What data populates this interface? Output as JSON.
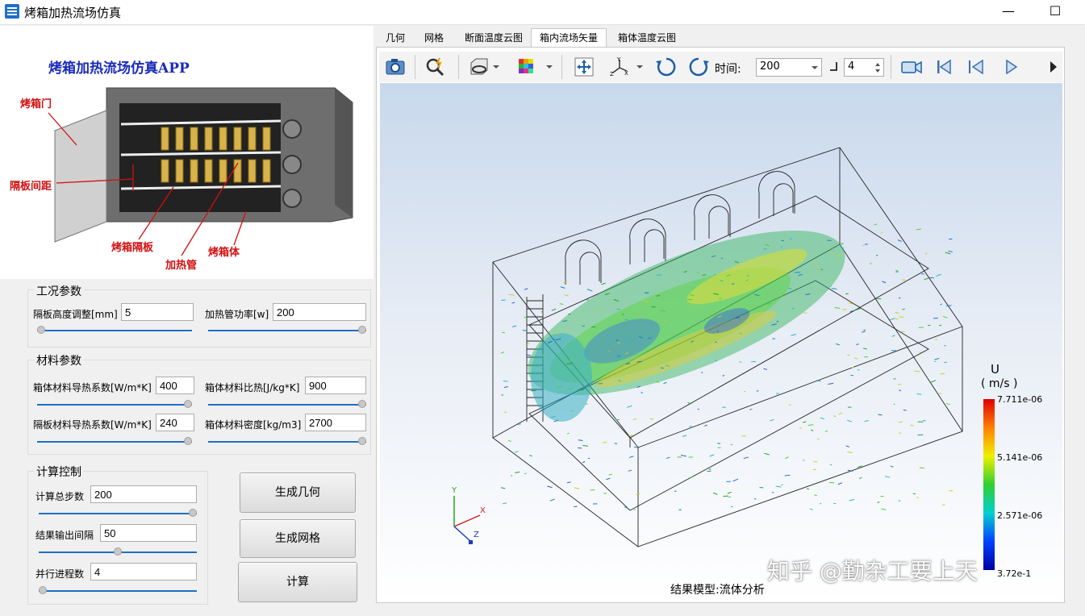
{
  "window": {
    "title": "烤箱加热流场仿真",
    "minimize": "—",
    "maximize": "☐"
  },
  "illustration": {
    "heading": "烤箱加热流场仿真APP",
    "labels": {
      "door": "烤箱门",
      "spacing": "隔板间距",
      "shelf": "烤箱隔板",
      "heater": "加热管",
      "body": "烤箱体"
    }
  },
  "operating": {
    "title": "工况参数",
    "shelf_height": {
      "label": "隔板高度调整[mm]",
      "value": "5",
      "slider": 0.0
    },
    "heater_power": {
      "label": "加热管功率[w]",
      "value": "200",
      "slider": 1.0
    }
  },
  "material": {
    "title": "材料参数",
    "body_k": {
      "label": "箱体材料导热系数[W/m*K]",
      "value": "400",
      "slider": 1.0
    },
    "body_cp": {
      "label": "箱体材料比热[J/kg*K]",
      "value": "900",
      "slider": 1.0
    },
    "shelf_k": {
      "label": "隔板材料导热系数[W/m*K]",
      "value": "240",
      "slider": 1.0
    },
    "body_rho": {
      "label": "箱体材料密度[kg/m3]",
      "value": "2700",
      "slider": 1.0
    }
  },
  "compute": {
    "title": "计算控制",
    "total_steps": {
      "label": "计算总步数",
      "value": "200",
      "slider": 1.0
    },
    "output_interval": {
      "label": "结果输出间隔",
      "value": "50",
      "slider": 0.5
    },
    "parallel": {
      "label": "并行进程数",
      "value": "4",
      "slider": 0.0
    }
  },
  "buttons": {
    "gen_geometry": "生成几何",
    "gen_mesh": "生成网格",
    "compute": "计算"
  },
  "tabs": [
    "几何",
    "网格",
    "断面温度云图",
    "箱内流场矢量",
    "箱体温度云图"
  ],
  "active_tab": 3,
  "toolbar": {
    "time_label": "时间:",
    "time_value": "200",
    "step_value": "4"
  },
  "viewer": {
    "colorbar": {
      "title": "U",
      "unit": "( m/s )",
      "max": "7.711e-06",
      "v2": "5.141e-06",
      "v3": "2.571e-06",
      "min": "3.72e-1"
    },
    "axes": {
      "y": "Y",
      "x": "X",
      "z": "Z"
    },
    "caption": "结果模型:流体分析",
    "watermark": "知乎 @勤杂工要上天"
  }
}
